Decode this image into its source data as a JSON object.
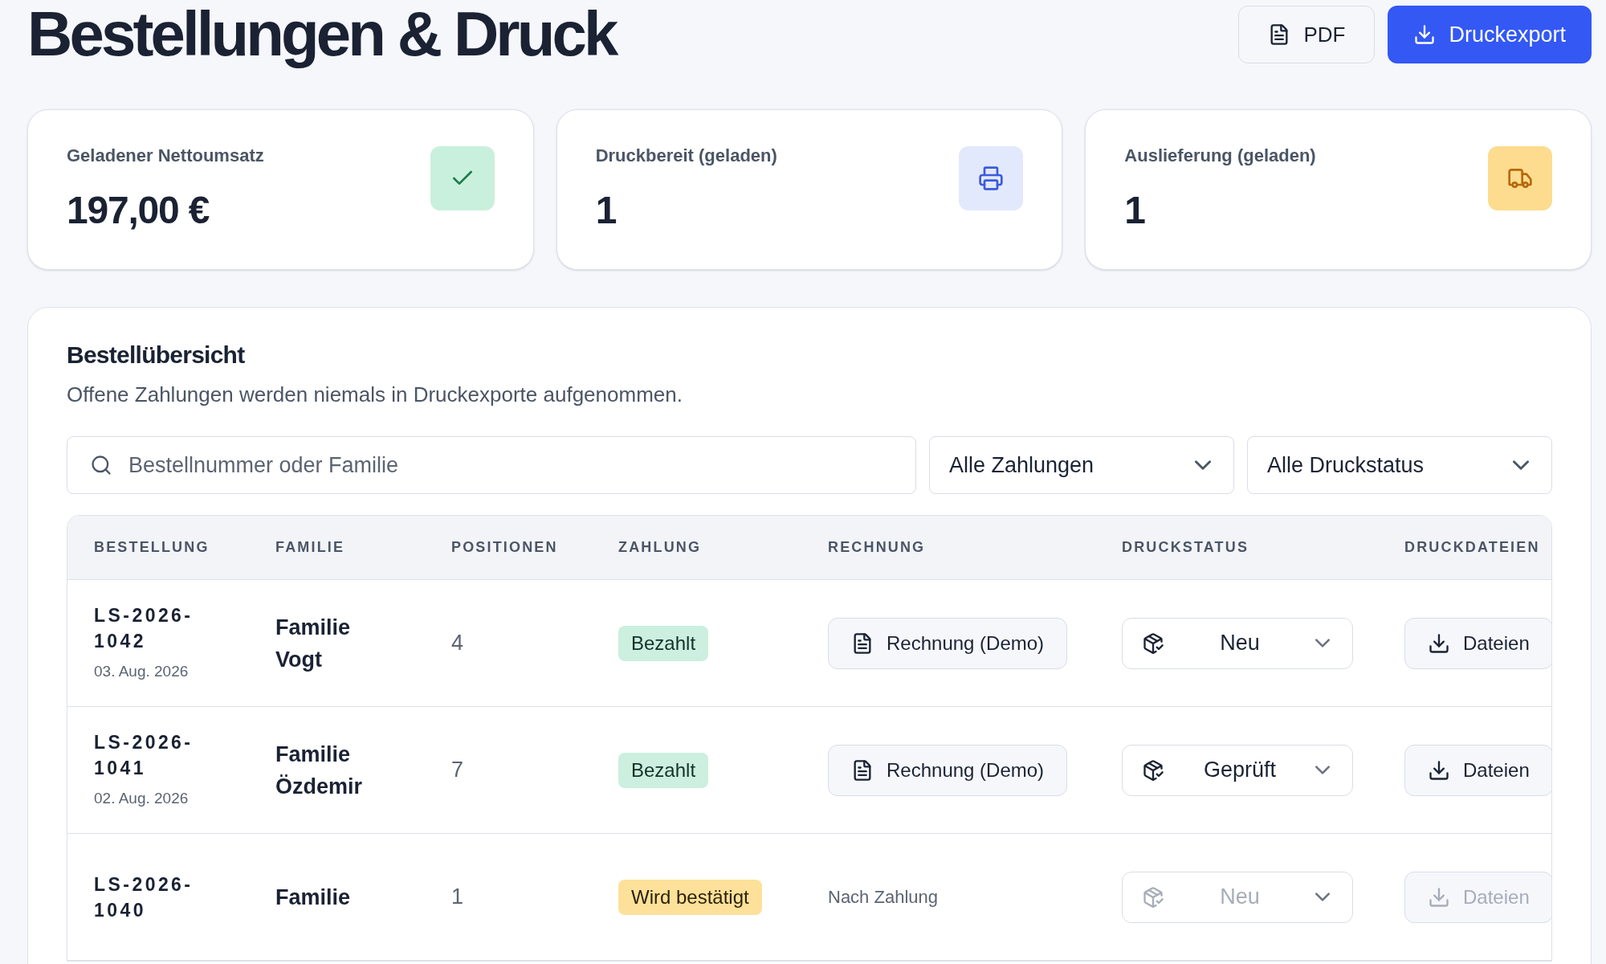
{
  "title": "Bestellungen & Druck",
  "actions": [
    {
      "kind": "pdf",
      "label": "PDF"
    },
    {
      "kind": "export",
      "label": "Druckexport"
    }
  ],
  "stats": [
    {
      "label": "Geladener Nettoumsatz",
      "value": "197,00 €",
      "kind": "check"
    },
    {
      "label": "Druckbereit (geladen)",
      "value": "1",
      "kind": "printer"
    },
    {
      "label": "Auslieferung (geladen)",
      "value": "1",
      "kind": "truck"
    }
  ],
  "overview": {
    "title": "Bestellübersicht",
    "subtitle": "Offene Zahlungen werden niemals in Druckexporte aufgenommen.",
    "search": {
      "placeholder": "Bestellnummer oder Familie"
    },
    "filters": [
      "Alle Zahlungen",
      "Alle Druckstatus"
    ],
    "table": {
      "columns": [
        "BESTELLUNG",
        "FAMILIE",
        "POSITIONEN",
        "ZAHLUNG",
        "RECHNUNG",
        "DRUCKSTATUS",
        "DRUCKDATEIEN"
      ],
      "rows": [
        {
          "order": "LS-2026-\n1042",
          "date": "03. Aug. 2026",
          "family": "Familie\nVogt",
          "positions": "4",
          "payment": {
            "label": "Bezahlt",
            "kind": "paid"
          },
          "invoice": {
            "kind": "button",
            "label": "Rechnung (Demo)"
          },
          "print_status": {
            "label": "Neu",
            "disabled": false
          },
          "files": {
            "label": "Dateien",
            "disabled": false
          }
        },
        {
          "order": "LS-2026-\n1041",
          "date": "02. Aug. 2026",
          "family": "Familie\nÖzdemir",
          "positions": "7",
          "payment": {
            "label": "Bezahlt",
            "kind": "paid"
          },
          "invoice": {
            "kind": "button",
            "label": "Rechnung (Demo)"
          },
          "print_status": {
            "label": "Geprüft",
            "disabled": false
          },
          "files": {
            "label": "Dateien",
            "disabled": false
          }
        },
        {
          "order": "LS-2026-\n1040",
          "family": "Familie",
          "positions": "1",
          "payment": {
            "label": "Wird bestätigt",
            "kind": "pending"
          },
          "invoice": {
            "kind": "text",
            "label": "Nach Zahlung"
          },
          "print_status": {
            "label": "Neu",
            "disabled": true
          },
          "files": {
            "label": "Dateien",
            "disabled": true
          }
        }
      ]
    }
  }
}
